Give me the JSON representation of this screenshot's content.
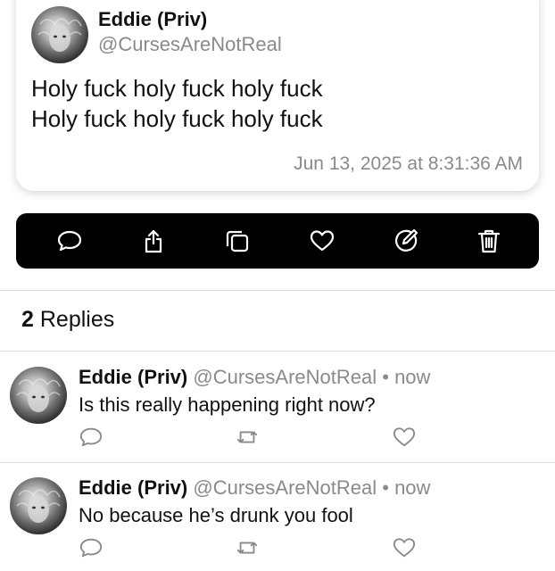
{
  "post": {
    "author_name": "Eddie (Priv)",
    "author_handle": "@CursesAreNotReal",
    "body_line1": "Holy fuck holy fuck holy fuck",
    "body_line2": "Holy fuck holy fuck holy fuck",
    "timestamp": "Jun 13, 2025 at 8:31:36 AM"
  },
  "toolbar": {
    "icons": [
      "reply-icon",
      "share-icon",
      "copy-icon",
      "like-icon",
      "edit-icon",
      "delete-icon"
    ]
  },
  "replies_section": {
    "count": "2",
    "label": "Replies"
  },
  "replies": [
    {
      "author_name": "Eddie (Priv)",
      "author_handle": "@CursesAreNotReal",
      "separator": "•",
      "time": "now",
      "text": "Is this really happening right now?"
    },
    {
      "author_name": "Eddie (Priv)",
      "author_handle": "@CursesAreNotReal",
      "separator": "•",
      "time": "now",
      "text": "No because he’s drunk you fool"
    }
  ],
  "colors": {
    "secondary_text": "#8a8a8e",
    "toolbar_bg": "#000000",
    "divider": "#dcdcdc"
  }
}
